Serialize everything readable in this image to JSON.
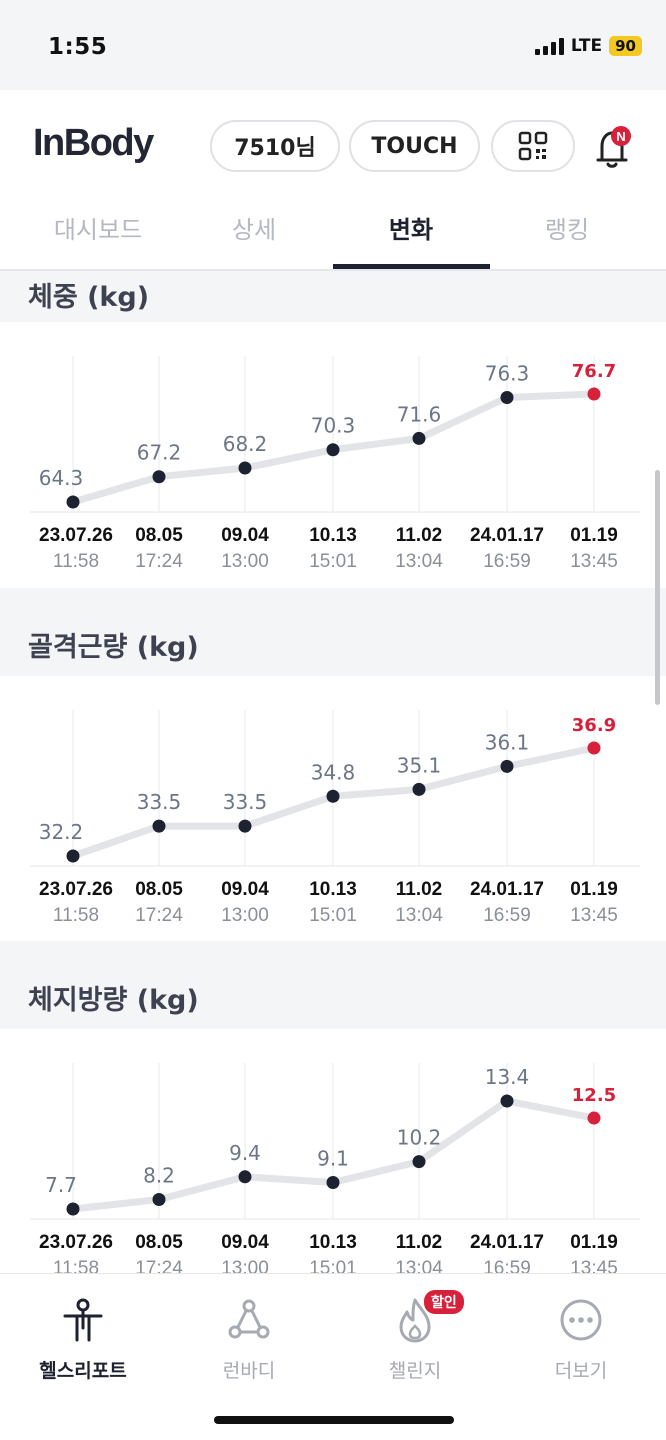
{
  "status_bar": {
    "time": "1:55",
    "network": "LTE",
    "battery": "90"
  },
  "header": {
    "logo": "InBody",
    "user_button": "7510님",
    "touch_button": "TOUCH",
    "qr_icon": "qr-code-icon",
    "bell_icon": "bell-icon",
    "notification_badge": "N"
  },
  "tabs": [
    {
      "label": "대시보드",
      "active": false
    },
    {
      "label": "상세",
      "active": false
    },
    {
      "label": "변화",
      "active": true
    },
    {
      "label": "랭킹",
      "active": false
    }
  ],
  "colors": {
    "accent": "#d7203a",
    "point": "#1d2230",
    "line": "#e3e4e7",
    "value_label": "#6b7686"
  },
  "charts": [
    {
      "title": "체중 (kg)",
      "chart_data": {
        "type": "line",
        "x": [
          "23.07.26 11:58",
          "08.05 17:24",
          "09.04 13:00",
          "10.13 15:01",
          "11.02 13:04",
          "24.01.17 16:59",
          "01.19 13:45"
        ],
        "dates": [
          "23.07.26",
          "08.05",
          "09.04",
          "10.13",
          "11.02",
          "24.01.17",
          "01.19"
        ],
        "times": [
          "11:58",
          "17:24",
          "13:00",
          "15:01",
          "13:04",
          "16:59",
          "13:45"
        ],
        "values": [
          64.3,
          67.2,
          68.2,
          70.3,
          71.6,
          76.3,
          76.7
        ],
        "labels": [
          "64.3",
          "67.2",
          "68.2",
          "70.3",
          "71.6",
          "76.3",
          "76.7"
        ],
        "highlight_index": 6
      }
    },
    {
      "title": "골격근량 (kg)",
      "chart_data": {
        "type": "line",
        "x": [
          "23.07.26 11:58",
          "08.05 17:24",
          "09.04 13:00",
          "10.13 15:01",
          "11.02 13:04",
          "24.01.17 16:59",
          "01.19 13:45"
        ],
        "dates": [
          "23.07.26",
          "08.05",
          "09.04",
          "10.13",
          "11.02",
          "24.01.17",
          "01.19"
        ],
        "times": [
          "11:58",
          "17:24",
          "13:00",
          "15:01",
          "13:04",
          "16:59",
          "13:45"
        ],
        "values": [
          32.2,
          33.5,
          33.5,
          34.8,
          35.1,
          36.1,
          36.9
        ],
        "labels": [
          "32.2",
          "33.5",
          "33.5",
          "34.8",
          "35.1",
          "36.1",
          "36.9"
        ],
        "highlight_index": 6
      }
    },
    {
      "title": "체지방량 (kg)",
      "chart_data": {
        "type": "line",
        "x": [
          "23.07.26 11:58",
          "08.05 17:24",
          "09.04 13:00",
          "10.13 15:01",
          "11.02 13:04",
          "24.01.17 16:59",
          "01.19 13:45"
        ],
        "dates": [
          "23.07.26",
          "08.05",
          "09.04",
          "10.13",
          "11.02",
          "24.01.17",
          "01.19"
        ],
        "times": [
          "11:58",
          "17:24",
          "13:00",
          "15:01",
          "13:04",
          "16:59",
          "13:45"
        ],
        "values": [
          7.7,
          8.2,
          9.4,
          9.1,
          10.2,
          13.4,
          12.5
        ],
        "labels": [
          "7.7",
          "8.2",
          "9.4",
          "9.1",
          "10.2",
          "13.4",
          "12.5"
        ],
        "highlight_index": 6
      }
    }
  ],
  "bottom_nav": [
    {
      "label": "헬스리포트",
      "icon": "person-report-icon",
      "active": true
    },
    {
      "label": "런바디",
      "icon": "run-route-icon",
      "active": false
    },
    {
      "label": "챌린지",
      "icon": "flame-icon",
      "active": false,
      "badge": "할인"
    },
    {
      "label": "더보기",
      "icon": "more-dots-icon",
      "active": false
    }
  ]
}
